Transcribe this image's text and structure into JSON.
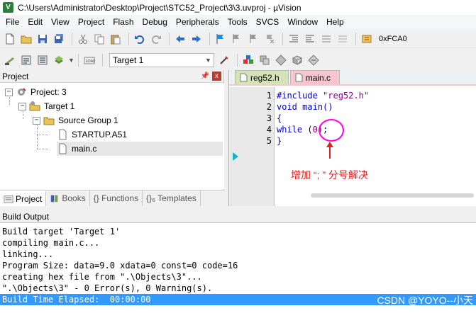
{
  "window": {
    "app_icon_text": "V",
    "title": "C:\\Users\\Administrator\\Desktop\\Project\\STC52_Project\\3\\3.uvproj - µVision"
  },
  "menu": [
    "File",
    "Edit",
    "View",
    "Project",
    "Flash",
    "Debug",
    "Peripherals",
    "Tools",
    "SVCS",
    "Window",
    "Help"
  ],
  "toolbar": {
    "address_value": "0xFCA0",
    "target_value": "Target 1"
  },
  "project_panel": {
    "title": "Project",
    "pin_icon": "pin-icon",
    "close_label": "x",
    "tree": {
      "project": "Project: 3",
      "target": "Target 1",
      "group": "Source Group 1",
      "file1": "STARTUP.A51",
      "file2": "main.c"
    },
    "tabs": [
      "Project",
      "Books",
      "{} Functions",
      "{}₆ Templates"
    ]
  },
  "editor": {
    "tabs": [
      "reg52.h",
      "main.c"
    ],
    "active_tab": "main.c",
    "lines": [
      {
        "num": "1",
        "pre": "#include ",
        "str": "\"reg52.h\"",
        "post": ""
      },
      {
        "num": "2",
        "pre": "void main()",
        "str": "",
        "post": ""
      },
      {
        "num": "3",
        "pre": "{",
        "str": "",
        "post": ""
      },
      {
        "num": "4",
        "kw": "while",
        "pre": " (",
        "str": "0",
        "post": ");"
      },
      {
        "num": "5",
        "pre": "}",
        "str": "",
        "post": ""
      }
    ],
    "annotation": "增加 “; ” 分号解决",
    "annotation_color": "#e02020",
    "circle_color": "#ff00e6"
  },
  "build_output": {
    "title": "Build Output",
    "lines": [
      "Build target 'Target 1'",
      "compiling main.c...",
      "linking...",
      "Program Size: data=9.0 xdata=0 const=0 code=16",
      "creating hex file from \".\\Objects\\3\"...",
      "\".\\Objects\\3\" - 0 Error(s), 0 Warning(s)."
    ],
    "elapsed": "Build Time Elapsed:  00:00:00"
  },
  "watermark": "CSDN @YOYO--小天",
  "colors": {
    "elapsed_bg": "#3399ff",
    "tab_inactive": "#d4e4b8",
    "tab_active": "#f6c6ce",
    "keyword": "#0000cc",
    "string": "#8b008b"
  }
}
